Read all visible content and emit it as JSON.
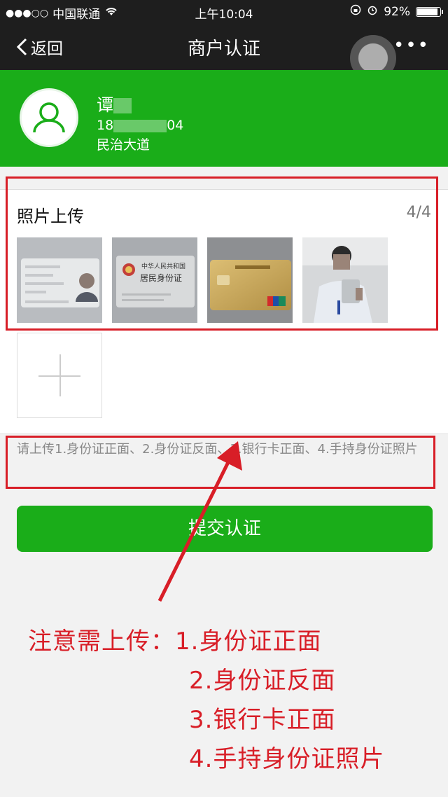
{
  "status_bar": {
    "signal": "●●●○○",
    "carrier": "中国联通",
    "time": "上午10:04",
    "battery_percent": "92%",
    "battery_level": 0.92
  },
  "nav": {
    "back_label": "返回",
    "title": "商户认证",
    "more_label": "•••"
  },
  "profile": {
    "name": "谭",
    "phone_prefix": "18",
    "phone_suffix": "04",
    "address": "民治大道"
  },
  "upload": {
    "title": "照片上传",
    "count": "4/4",
    "thumbnails": [
      "id-card-front-photo",
      "id-card-back-photo",
      "bank-card-photo",
      "holding-id-card-photo"
    ]
  },
  "id_back_text": {
    "line1": "中华人民共和国",
    "line2": "居民身份证"
  },
  "hint": "请上传1.身份证正面、2.身份证反面、3.银行卡正面、4.手持身份证照片",
  "submit_label": "提交认证",
  "notice": {
    "line1": "注意需上传：1.身份证正面",
    "line2": "2.身份证反面",
    "line3": "3.银行卡正面",
    "line4": "4.手持身份证照片"
  },
  "colors": {
    "accent_green": "#1aad19",
    "annotation_red": "#d81e27",
    "nav_bg": "#1e1e1e"
  }
}
